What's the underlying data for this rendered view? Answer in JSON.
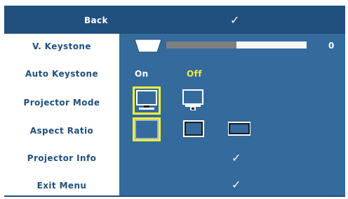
{
  "menu": {
    "back_label": "Back",
    "rows": {
      "v_keystone": "V. Keystone",
      "auto_keystone": "Auto Keystone",
      "projector_mode": "Projector Mode",
      "aspect_ratio": "Aspect Ratio",
      "projector_info": "Projector Info",
      "exit_menu": "Exit Menu"
    }
  },
  "v_keystone": {
    "value": "0",
    "fill_fraction": 0.5
  },
  "auto_keystone": {
    "on_label": "On",
    "off_label": "Off",
    "selected": "Off"
  },
  "projector_mode": {
    "options": [
      "front-table-projection-icon",
      "ceiling-mount-projection-icon"
    ],
    "selected_index": 0
  },
  "aspect_ratio": {
    "options": [
      "aspect-original-icon",
      "aspect-4-3-icon",
      "aspect-wide-icon"
    ],
    "selected_index": 0
  },
  "glyphs": {
    "check": "✓"
  },
  "colors": {
    "panel": "#346a9c",
    "header": "#1f4f7d",
    "label_text": "#1f4f7d",
    "highlight": "#f5ef3a"
  }
}
